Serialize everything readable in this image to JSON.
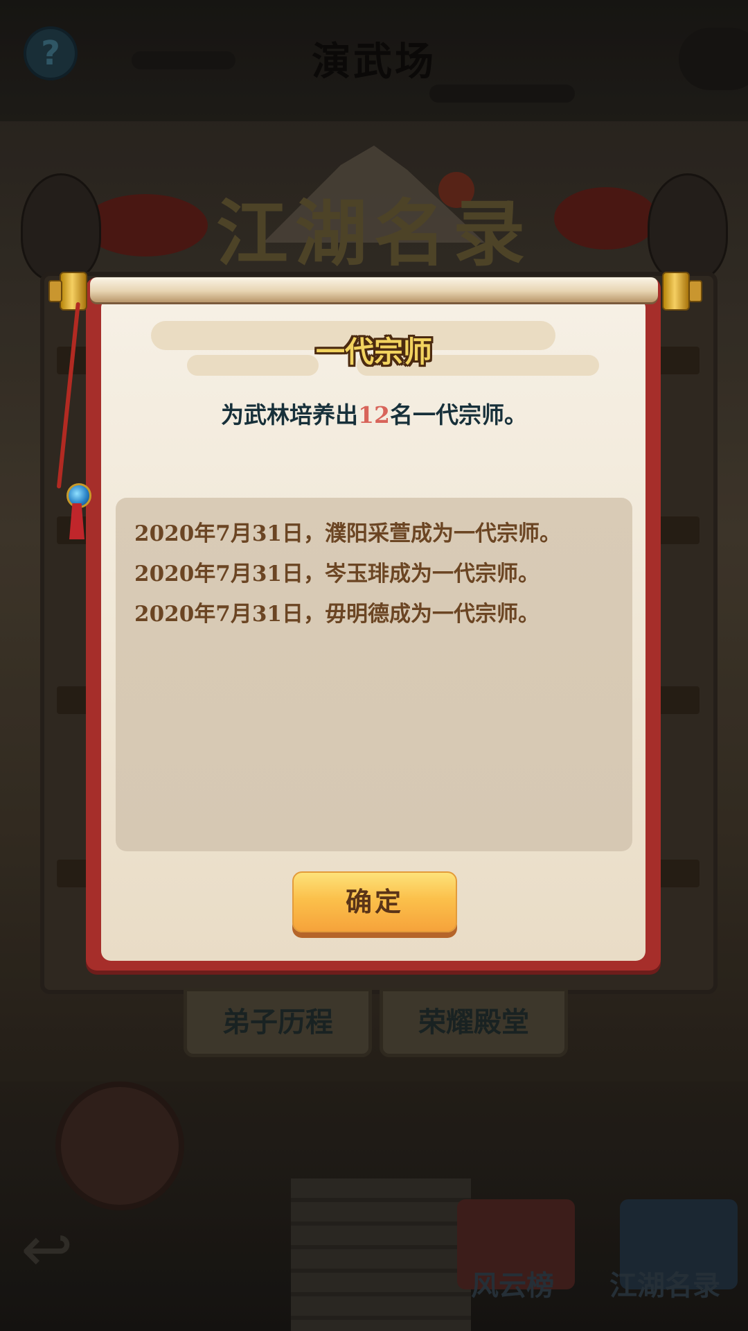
{
  "background": {
    "scene_title": "演武场",
    "banner_title": "江湖名录",
    "tabs": [
      "弟子历程",
      "荣耀殿堂"
    ],
    "nav": [
      "风云榜",
      "江湖名录"
    ]
  },
  "dialog": {
    "title": "一代宗师",
    "description": {
      "prefix": "为武林培养出",
      "count": "12",
      "suffix": "名一代宗师。"
    },
    "records": [
      "2020年7月31日，濮阳采萱成为一代宗师。",
      "2020年7月31日，岑玉琲成为一代宗师。",
      "2020年7月31日，毋明德成为一代宗师。"
    ],
    "confirm_label": "确定"
  },
  "icons": {
    "help": "question-mark-icon",
    "back": "back-arrow-icon"
  },
  "colors": {
    "scroll_frame": "#a62e2a",
    "paper": "#f3ebdc",
    "record_text": "#6b4523",
    "count_highlight": "#d8645a",
    "button_gold": "#fbc04b"
  }
}
